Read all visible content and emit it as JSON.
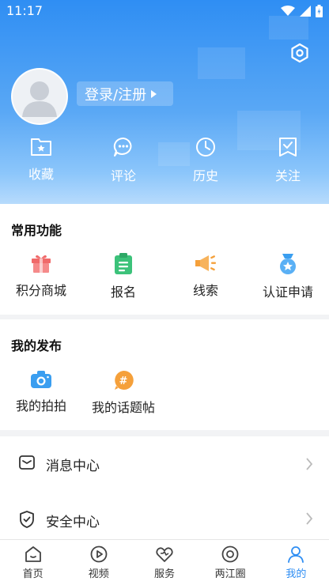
{
  "status_bar": {
    "time": "11:17",
    "icons": [
      "wifi-icon",
      "signal-icon",
      "battery-icon"
    ]
  },
  "header": {
    "login_label": "登录/注册",
    "quick_actions": [
      {
        "label": "收藏",
        "icon": "favorite-icon"
      },
      {
        "label": "评论",
        "icon": "comment-icon"
      },
      {
        "label": "历史",
        "icon": "history-icon"
      },
      {
        "label": "关注",
        "icon": "follow-icon"
      }
    ]
  },
  "common_functions": {
    "title": "常用功能",
    "items": [
      {
        "label": "积分商城",
        "icon": "gift-icon",
        "color": "#f06a6a"
      },
      {
        "label": "报名",
        "icon": "clipboard-icon",
        "color": "#3cc27a"
      },
      {
        "label": "线索",
        "icon": "megaphone-icon",
        "color": "#f5a03a"
      },
      {
        "label": "认证申请",
        "icon": "badge-icon",
        "color": "#3a9ef0"
      }
    ]
  },
  "my_posts": {
    "title": "我的发布",
    "items": [
      {
        "label": "我的拍拍",
        "icon": "camera-icon",
        "color": "#3a9ef0"
      },
      {
        "label": "我的话题帖",
        "icon": "hashtag-icon",
        "color": "#f5a03a"
      }
    ]
  },
  "menu": [
    {
      "label": "消息中心",
      "icon": "message-icon"
    },
    {
      "label": "安全中心",
      "icon": "shield-icon"
    }
  ],
  "tabbar": [
    {
      "label": "首页",
      "icon": "home-icon"
    },
    {
      "label": "视频",
      "icon": "video-icon"
    },
    {
      "label": "服务",
      "icon": "service-icon"
    },
    {
      "label": "两江圈",
      "icon": "circle-icon"
    },
    {
      "label": "我的",
      "icon": "profile-icon",
      "active": true
    }
  ],
  "colors": {
    "accent": "#2f8ef3",
    "header_top": "#2f8ef3",
    "header_bottom": "#b7dbfc"
  }
}
